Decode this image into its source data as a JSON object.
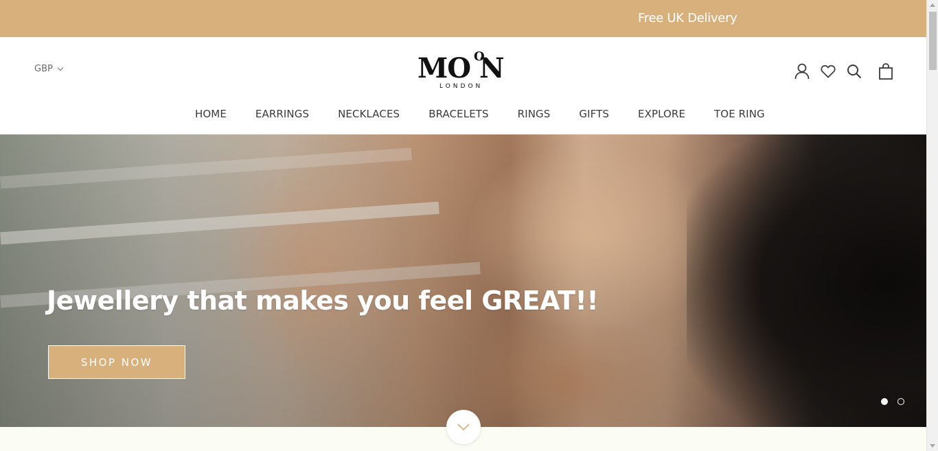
{
  "announcement": {
    "text": "Free UK Delivery"
  },
  "header": {
    "currency": "GBP",
    "logo": {
      "main": "MO N",
      "sup": "O",
      "sub": "LONDON"
    },
    "icons": [
      "account-icon",
      "wishlist-heart-icon",
      "search-icon",
      "cart-bag-icon"
    ],
    "nav": [
      "HOME",
      "EARRINGS",
      "NECKLACES",
      "BRACELETS",
      "RINGS",
      "GIFTS",
      "EXPLORE",
      "TOE RING"
    ]
  },
  "hero": {
    "title": "Jewellery that makes you feel GREAT!!",
    "cta": "SHOP NOW",
    "slides_total": 2,
    "active_slide": 1
  },
  "colors": {
    "accent": "#d8b07c",
    "text": "#3a3a3a",
    "below_bg": "#fbfcf3"
  }
}
